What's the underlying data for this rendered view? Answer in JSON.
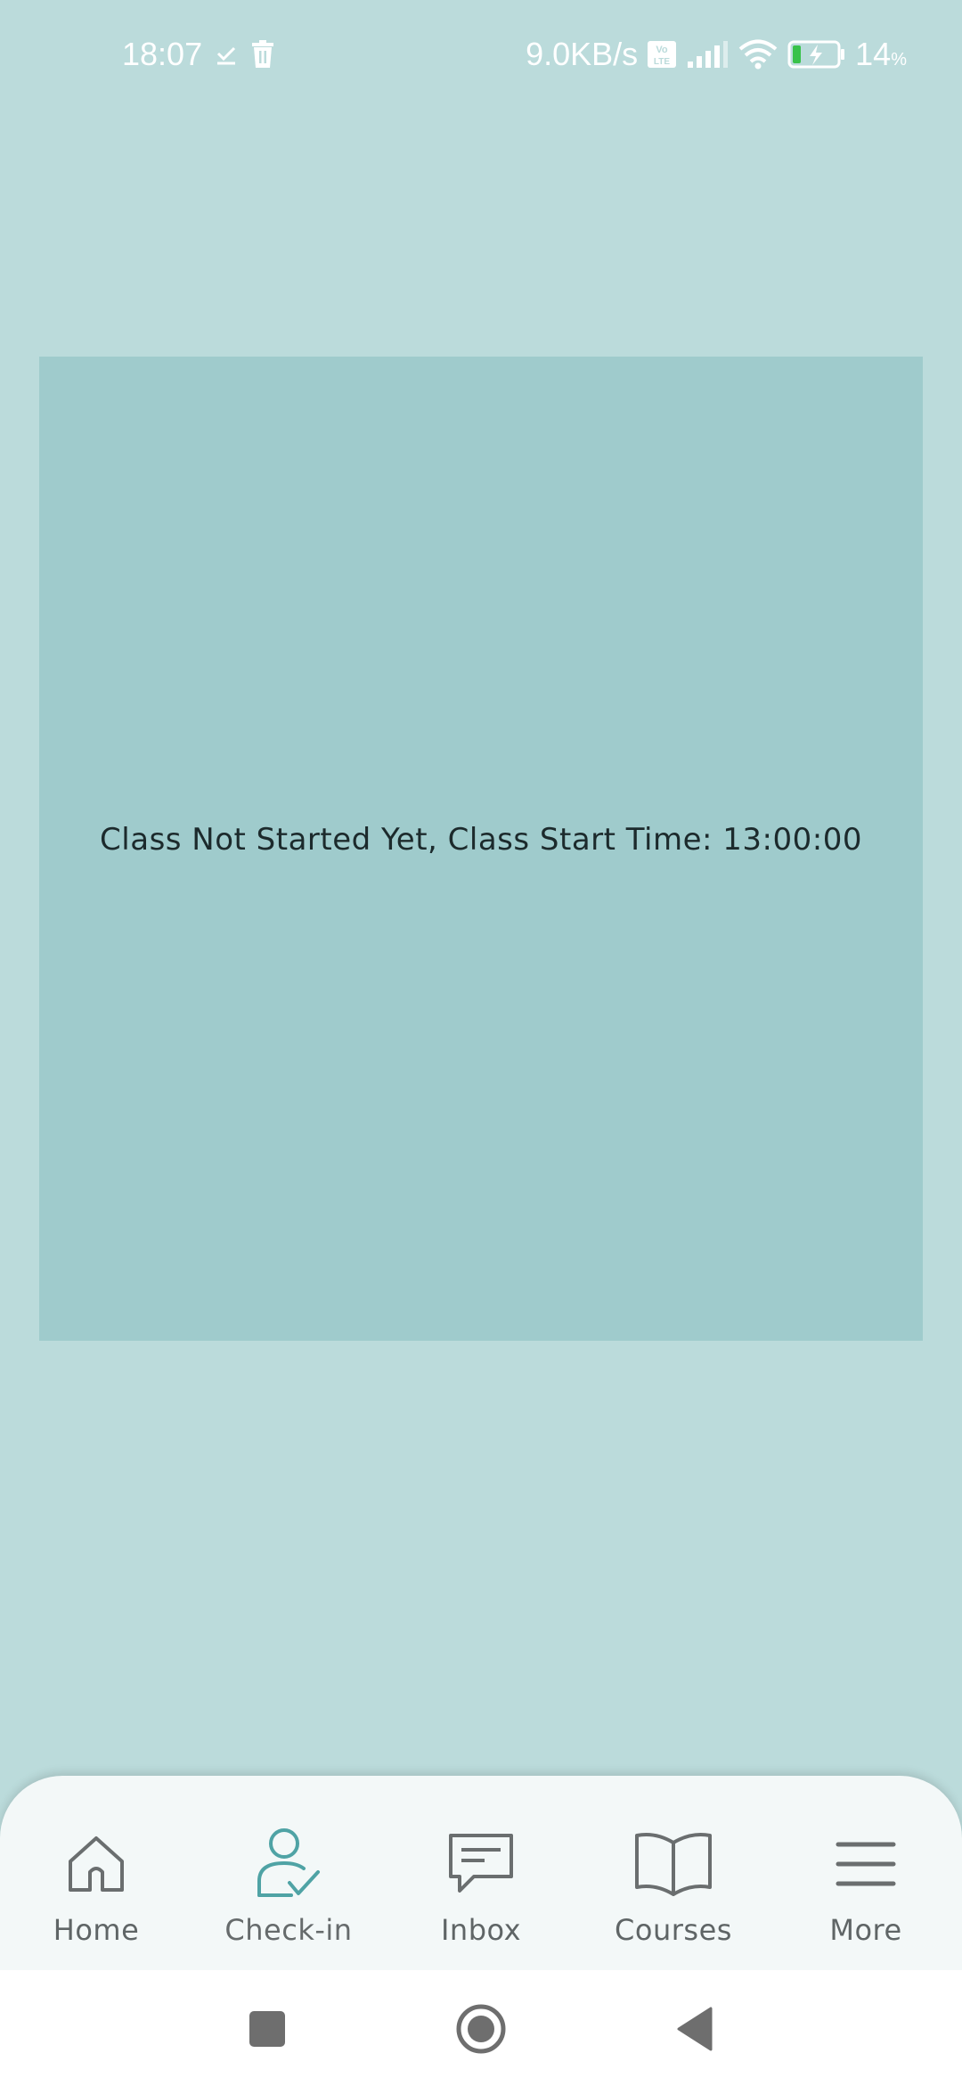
{
  "status_bar": {
    "time": "18:07",
    "network_speed": "9.0KB/s",
    "battery_percent": "14",
    "battery_unit": "%",
    "icons": [
      "download-done-icon",
      "trash-icon",
      "volte-icon",
      "signal-icon",
      "wifi-icon",
      "battery-charging-icon"
    ]
  },
  "main": {
    "message": "Class Not Started Yet, Class Start Time: 13:00:00"
  },
  "bottom_nav": {
    "items": [
      {
        "label": "Home",
        "icon": "home-icon"
      },
      {
        "label": "Check-in",
        "icon": "check-in-user-icon"
      },
      {
        "label": "Inbox",
        "icon": "chat-icon"
      },
      {
        "label": "Courses",
        "icon": "book-icon"
      },
      {
        "label": "More",
        "icon": "menu-icon"
      }
    ],
    "active_index": 1
  },
  "system_nav": {
    "buttons": [
      "recents-button",
      "home-button",
      "back-button"
    ]
  },
  "colors": {
    "background": "#bbdbdb",
    "card": "#9fcbcc",
    "accent": "#4fa3a5",
    "nav_bg": "#f3f8f8",
    "icon_gray": "#6a6e6f"
  }
}
